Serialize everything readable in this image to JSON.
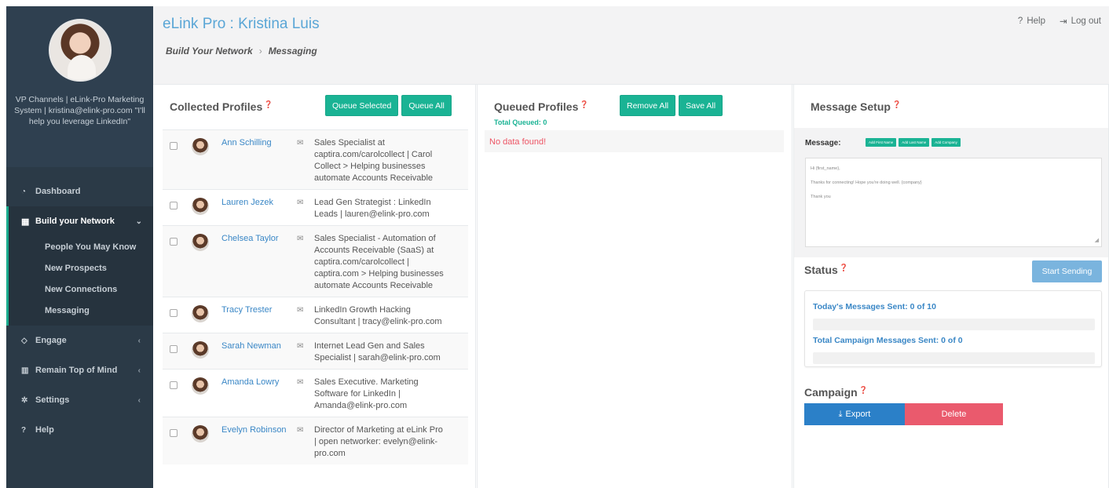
{
  "app": {
    "title": "eLink Pro : Kristina Luis"
  },
  "header": {
    "help_label": "Help",
    "help_icon": "question-icon",
    "logout_label": "Log out",
    "logout_icon": "sign-out-icon",
    "breadcrumb": [
      "Build Your Network",
      "Messaging"
    ]
  },
  "sidebar": {
    "bio": "VP Channels | eLink-Pro Marketing System | kristina@elink-pro.com \"I'll help you leverage LinkedIn\"",
    "items": [
      {
        "label": "Dashboard",
        "icon": "dashboard-icon"
      },
      {
        "label": "Build your Network",
        "icon": "grid-icon",
        "active": true,
        "children": [
          "People You May Know",
          "New Prospects",
          "New Connections",
          "Messaging"
        ]
      },
      {
        "label": "Engage",
        "icon": "diamond-icon"
      },
      {
        "label": "Remain Top of Mind",
        "icon": "bar-chart-icon"
      },
      {
        "label": "Settings",
        "icon": "gear-icon"
      },
      {
        "label": "Help",
        "icon": "question-icon"
      }
    ]
  },
  "collected": {
    "title": "Collected Profiles",
    "queue_selected_label": "Queue Selected",
    "queue_all_label": "Queue All",
    "profiles": [
      {
        "name": "Ann Schilling",
        "desc": "Sales Specialist at captira.com/carolcollect | Carol Collect > Helping businesses automate Accounts Receivable"
      },
      {
        "name": "Lauren Jezek",
        "desc": "Lead Gen Strategist : LinkedIn Leads | lauren@elink-pro.com"
      },
      {
        "name": "Chelsea Taylor",
        "desc": "Sales Specialist - Automation of Accounts Receivable (SaaS) at captira.com/carolcollect | captira.com > Helping businesses automate Accounts Receivable"
      },
      {
        "name": "Tracy Trester",
        "desc": "LinkedIn Growth Hacking Consultant | tracy@elink-pro.com"
      },
      {
        "name": "Sarah Newman",
        "desc": "Internet Lead Gen and Sales Specialist | sarah@elink-pro.com"
      },
      {
        "name": "Amanda Lowry",
        "desc": "Sales Executive. Marketing Software for LinkedIn | Amanda@elink-pro.com"
      },
      {
        "name": "Evelyn Robinson",
        "desc": "Director of Marketing at eLink Pro | open networker: evelyn@elink-pro.com"
      }
    ]
  },
  "queued": {
    "title": "Queued Profiles",
    "total_label": "Total Queued: 0",
    "remove_all_label": "Remove All",
    "save_all_label": "Save All",
    "empty_text": "No data found!"
  },
  "message": {
    "title": "Message Setup",
    "label": "Message:",
    "tags": [
      "Add First Name",
      "Add Last Name",
      "Add Company"
    ],
    "body_lines": [
      "Hi {first_name},",
      "Thanks for connecting! Hope you're doing well. {company}",
      "Thank you"
    ]
  },
  "status": {
    "title": "Status",
    "start_label": "Start Sending",
    "today_label": "Today's Messages Sent: 0 of 10",
    "today_progress": 0,
    "total_label": "Total Campaign Messages Sent: 0 of 0",
    "total_progress": 0
  },
  "campaign": {
    "title": "Campaign",
    "export_label": "Export",
    "delete_label": "Delete"
  },
  "colors": {
    "accent_green": "#1ab394",
    "link_blue": "#3a87c6",
    "danger": "#ed5565",
    "sidebar": "#2f4050"
  }
}
